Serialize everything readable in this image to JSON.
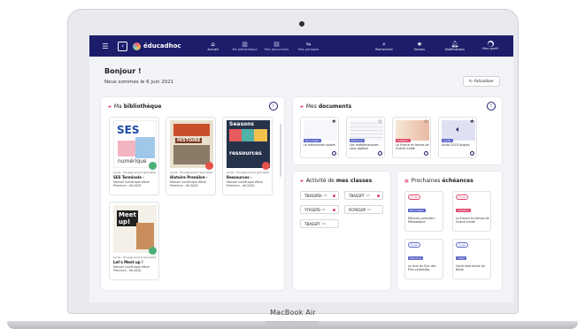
{
  "device_label": "MacBook Air",
  "nav": {
    "brand": "éducadhoc",
    "tabs": [
      {
        "label": "Accueil",
        "icon": "home-icon"
      },
      {
        "label": "Ma bibliothèque",
        "icon": "library-icon"
      },
      {
        "label": "Mes documents",
        "icon": "documents-icon"
      },
      {
        "label": "Mes partages",
        "icon": "share-icon"
      }
    ],
    "right": [
      {
        "label": "Rechercher",
        "icon": "search-icon"
      },
      {
        "label": "Favoris",
        "icon": "star-icon"
      },
      {
        "label": "Notifications",
        "icon": "bell-icon"
      },
      {
        "label": "Mon profil",
        "icon": "user-icon"
      }
    ]
  },
  "greeting": "Bonjour !",
  "date_text": "Nous sommes le 6 juin 2021",
  "refresh_label": "Actualiser",
  "library": {
    "title_prefix": "Ma",
    "title_bold": "bibliothèque",
    "books": [
      {
        "cover_title": "SES",
        "cover_sub": "numérique",
        "tag": "Lycée · Enseignement spécialité",
        "title": "SES Terminale -",
        "subtitle": "Manuel numérique élève Premium - éd.2020"
      },
      {
        "cover_title": "HISTOIRE",
        "cover_sub": "",
        "tag": "Lycée · Enseignement spécialité",
        "title": "Histoire Première -",
        "subtitle": "Manuel numérique élève Premium - éd.2020"
      },
      {
        "cover_title": "Seasons",
        "cover_sub": "ressources",
        "tag": "Lycée · Enseignement spécialité",
        "title": "Ressources -",
        "subtitle": "Manuel numérique élève Premium - éd.2020"
      },
      {
        "cover_title": "Meet up!",
        "cover_sub": "",
        "tag": "Lycée · Enseignement spécialité",
        "title": "Let's Meet up !",
        "subtitle": "Manuel numérique élève Premium - éd.2020"
      }
    ]
  },
  "documents": {
    "title_prefix": "Mes",
    "title_bold": "documents",
    "items": [
      {
        "type": "Document",
        "name": "Le mécanisme solaire",
        "starred": true
      },
      {
        "type": "Exercice",
        "name": "Les mathématiques sans algèbre",
        "starred": false
      },
      {
        "type": "Création",
        "name": "La France en temps de Guerre froide",
        "starred": false
      },
      {
        "type": "Audio",
        "name": "Audio 2070 Anglais",
        "starred": true
      }
    ]
  },
  "classes": {
    "title_prefix": "Activité de",
    "title_bold": "mes classes",
    "items": [
      {
        "name": "TBASSPDI",
        "status": "03",
        "dot": true
      },
      {
        "name": "TBASSPT",
        "status": "03",
        "dot": true
      },
      {
        "name": "YTASSPD",
        "status": "03",
        "dot": true
      },
      {
        "name": "PCMSSOP",
        "status": "03",
        "dot": false
      },
      {
        "name": "TBASSPT",
        "status": "03",
        "dot": false
      }
    ]
  },
  "deadlines": {
    "title_prefix": "Prochaines",
    "title_bold": "échéances",
    "items": [
      {
        "pill": "2 juin",
        "type": "Document",
        "name": "Révision première – Mésozoïque"
      },
      {
        "pill": "5 juin",
        "type": "Création",
        "name": "La France en temps de Guerre froide"
      },
      {
        "pill": "8 juin",
        "type": "Exercice",
        "name": "Le livre du Duc des Plus cinéphiles"
      },
      {
        "pill": "9 juin",
        "type": "Carte",
        "name": "Carte interactive du Brésil"
      }
    ]
  },
  "colors": {
    "nav_bg": "#1c1d6b",
    "accent_pink": "#e0466b",
    "badge_green": "#4caf7a",
    "badge_red": "#e8504a"
  }
}
